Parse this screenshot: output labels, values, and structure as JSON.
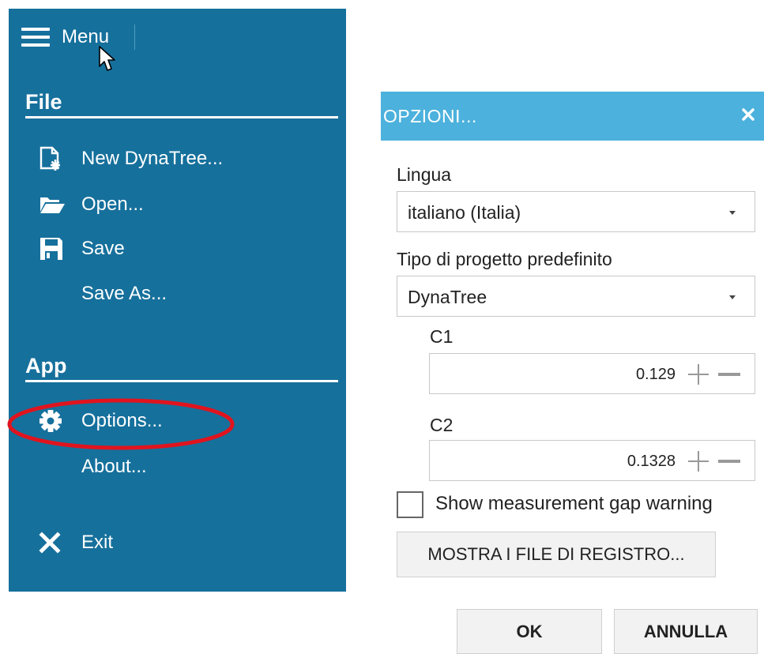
{
  "menu": {
    "title": "Menu",
    "sections": [
      {
        "title": "File"
      },
      {
        "title": "App"
      }
    ],
    "items": [
      {
        "label": "New DynaTree...",
        "icon": "new-file-icon"
      },
      {
        "label": "Open...",
        "icon": "open-folder-icon"
      },
      {
        "label": "Save",
        "icon": "save-icon"
      },
      {
        "label": "Save As...",
        "icon": ""
      },
      {
        "label": "Options...",
        "icon": "gear-icon"
      },
      {
        "label": "About...",
        "icon": ""
      },
      {
        "label": "Exit",
        "icon": "close-icon"
      }
    ],
    "colors": {
      "background": "#16709c",
      "text": "#ffffff",
      "highlight": "#e0141e"
    }
  },
  "dialog": {
    "title": "OPZIONI...",
    "language": {
      "label": "Lingua",
      "value": "italiano (Italia)"
    },
    "project_type": {
      "label": "Tipo di progetto predefinito",
      "value": "DynaTree"
    },
    "c1": {
      "label": "C1",
      "value": "0.129"
    },
    "c2": {
      "label": "C2",
      "value": "0.1328"
    },
    "gap_warning": {
      "label": "Show measurement gap warning",
      "checked": false
    },
    "logs_button": "MOSTRA I FILE DI REGISTRO...",
    "ok_button": "OK",
    "cancel_button": "ANNULLA",
    "colors": {
      "titlebar": "#4cb1dc"
    }
  }
}
